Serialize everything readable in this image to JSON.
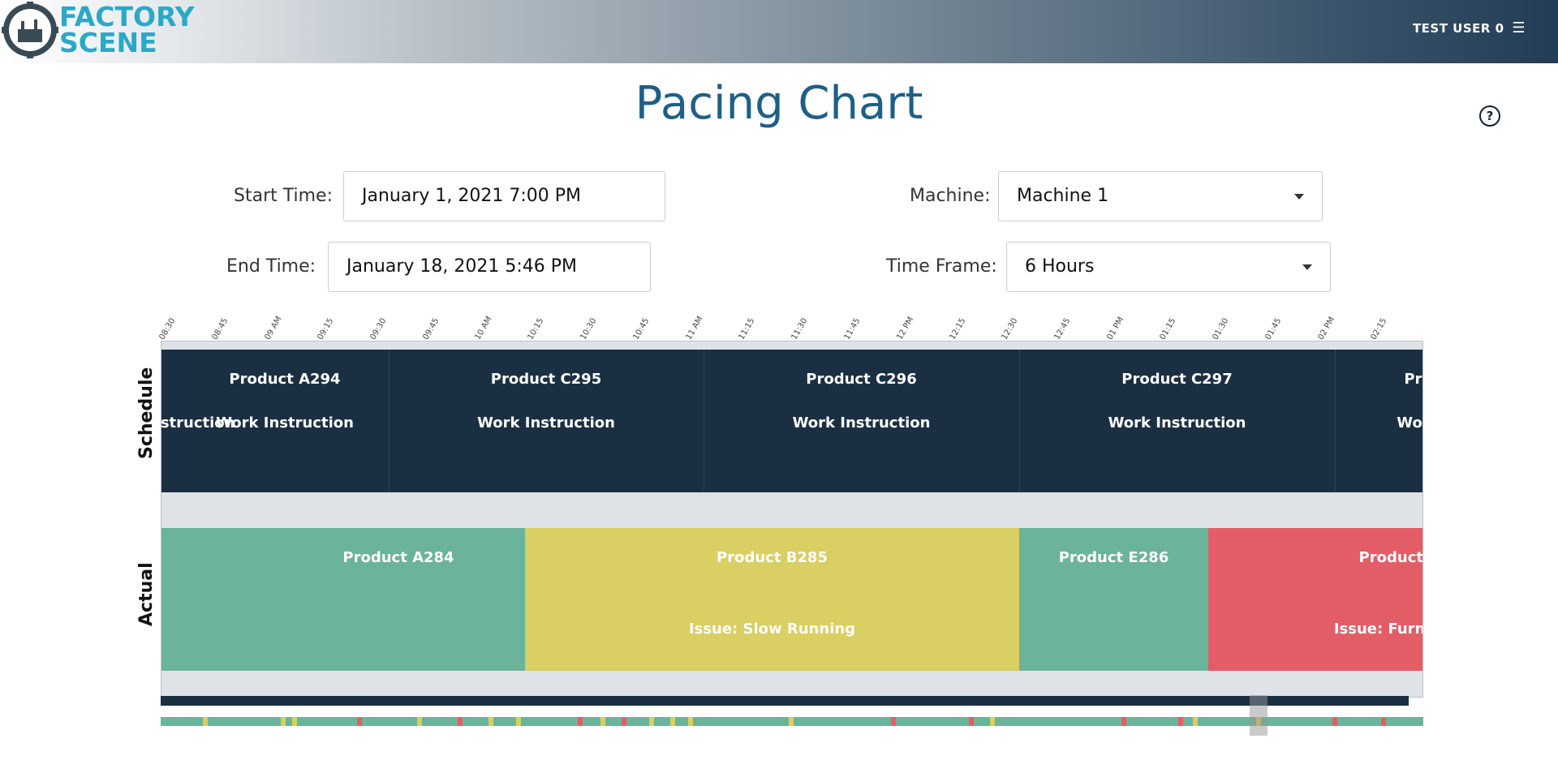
{
  "header": {
    "brand_line1": "FACTORY",
    "brand_line2": "SCENE",
    "user_label": "TEST USER 0",
    "menu_icon": "hamburger-icon"
  },
  "page": {
    "title": "Pacing Chart",
    "help_icon": "help-circle-icon"
  },
  "filters": {
    "start_label": "Start Time:",
    "start_value": "January 1, 2021 7:00 PM",
    "end_label": "End Time:",
    "end_value": "January 18, 2021 5:46 PM",
    "machine_label": "Machine:",
    "machine_value": "Machine 1",
    "timeframe_label": "Time Frame:",
    "timeframe_value": "6 Hours"
  },
  "timeline": {
    "ticks": [
      "08:30",
      "08:45",
      "09 AM",
      "09:15",
      "09:30",
      "09:45",
      "10 AM",
      "10:15",
      "10:30",
      "10:45",
      "11 AM",
      "11:15",
      "11:30",
      "11:45",
      "12 PM",
      "12:15",
      "12:30",
      "12:45",
      "01 PM",
      "01:15",
      "01:30",
      "01:45",
      "02 PM",
      "02:15"
    ]
  },
  "chart": {
    "schedule_label": "Schedule",
    "actual_label": "Actual",
    "schedule_partial_left": "nstruction",
    "schedule": [
      {
        "product": "Product A294",
        "note": "Work Instruction"
      },
      {
        "product": "Product C295",
        "note": "Work Instruction"
      },
      {
        "product": "Product C296",
        "note": "Work Instruction"
      },
      {
        "product": "Product C297",
        "note": "Work Instruction"
      },
      {
        "product": "Prod",
        "note": "Work I"
      }
    ],
    "actual": [
      {
        "product": "",
        "note": "",
        "color": "#6bb39a"
      },
      {
        "product": "Product A284",
        "note": "",
        "color": "#6bb39a"
      },
      {
        "product": "Product B285",
        "note": "Issue: Slow Running",
        "color": "#d9cf62"
      },
      {
        "product": "Product E286",
        "note": "",
        "color": "#6bb39a"
      },
      {
        "product": "Product C",
        "note": "Issue: Furnance",
        "color": "#e35d67"
      }
    ]
  }
}
